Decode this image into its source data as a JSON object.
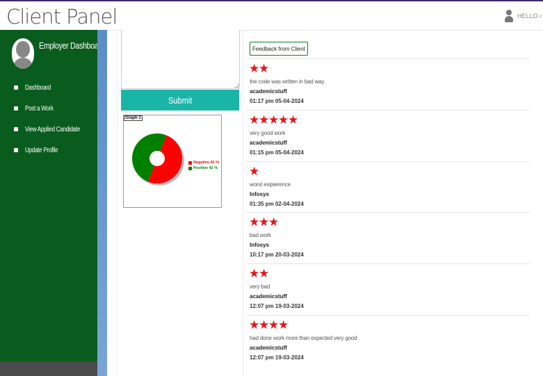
{
  "header": {
    "brand": "Client Panel",
    "user_label": "HELLO ‹"
  },
  "sidebar": {
    "title": "Employer Dashboard",
    "items": [
      {
        "label": "Dashboard"
      },
      {
        "label": "Post a Work"
      },
      {
        "label": "View Applied Candidate"
      },
      {
        "label": "Update Profile"
      }
    ]
  },
  "form": {
    "submit_label": "Submit"
  },
  "graph": {
    "tag": "Graph 1",
    "legend": [
      {
        "label": "Negative 42 %",
        "color": "#ff0000"
      },
      {
        "label": "Positive 42 %",
        "color": "#008000"
      }
    ]
  },
  "chart_data": {
    "type": "pie",
    "categories": [
      "Negative",
      "Positive"
    ],
    "values": [
      42,
      42
    ],
    "donut": true
  },
  "feedback": {
    "section_label": "Feedback from Client",
    "items": [
      {
        "stars": 2,
        "comment": "the code was written in bad way.",
        "user": "academicstuff",
        "time": "01:17 pm 05-04-2024"
      },
      {
        "stars": 5,
        "comment": "very good work",
        "user": "academicstuff",
        "time": "01:15 pm 05-04-2024"
      },
      {
        "stars": 1,
        "comment": "worst exipierence",
        "user": "Infosys",
        "time": "01:35 pm 02-04-2024"
      },
      {
        "stars": 3,
        "comment": "bad work",
        "user": "Infosys",
        "time": "10:17 pm 20-03-2024"
      },
      {
        "stars": 2,
        "comment": "very bad",
        "user": "academicstuff",
        "time": "12:07 pm 19-03-2024"
      },
      {
        "stars": 4,
        "comment": "had done work more than expected very good",
        "user": "academicstuff",
        "time": "12:07 pm 19-03-2024"
      }
    ]
  }
}
